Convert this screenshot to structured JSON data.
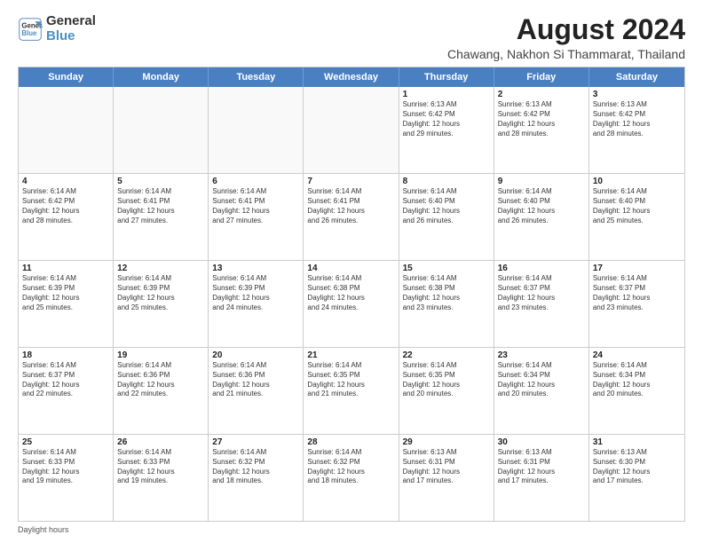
{
  "logo": {
    "line1": "General",
    "line2": "Blue"
  },
  "title": "August 2024",
  "location": "Chawang, Nakhon Si Thammarat, Thailand",
  "days_of_week": [
    "Sunday",
    "Monday",
    "Tuesday",
    "Wednesday",
    "Thursday",
    "Friday",
    "Saturday"
  ],
  "weeks": [
    [
      {
        "day": "",
        "text": "",
        "empty": true
      },
      {
        "day": "",
        "text": "",
        "empty": true
      },
      {
        "day": "",
        "text": "",
        "empty": true
      },
      {
        "day": "",
        "text": "",
        "empty": true
      },
      {
        "day": "1",
        "text": "Sunrise: 6:13 AM\nSunset: 6:42 PM\nDaylight: 12 hours\nand 29 minutes."
      },
      {
        "day": "2",
        "text": "Sunrise: 6:13 AM\nSunset: 6:42 PM\nDaylight: 12 hours\nand 28 minutes."
      },
      {
        "day": "3",
        "text": "Sunrise: 6:13 AM\nSunset: 6:42 PM\nDaylight: 12 hours\nand 28 minutes."
      }
    ],
    [
      {
        "day": "4",
        "text": "Sunrise: 6:14 AM\nSunset: 6:42 PM\nDaylight: 12 hours\nand 28 minutes."
      },
      {
        "day": "5",
        "text": "Sunrise: 6:14 AM\nSunset: 6:41 PM\nDaylight: 12 hours\nand 27 minutes."
      },
      {
        "day": "6",
        "text": "Sunrise: 6:14 AM\nSunset: 6:41 PM\nDaylight: 12 hours\nand 27 minutes."
      },
      {
        "day": "7",
        "text": "Sunrise: 6:14 AM\nSunset: 6:41 PM\nDaylight: 12 hours\nand 26 minutes."
      },
      {
        "day": "8",
        "text": "Sunrise: 6:14 AM\nSunset: 6:40 PM\nDaylight: 12 hours\nand 26 minutes."
      },
      {
        "day": "9",
        "text": "Sunrise: 6:14 AM\nSunset: 6:40 PM\nDaylight: 12 hours\nand 26 minutes."
      },
      {
        "day": "10",
        "text": "Sunrise: 6:14 AM\nSunset: 6:40 PM\nDaylight: 12 hours\nand 25 minutes."
      }
    ],
    [
      {
        "day": "11",
        "text": "Sunrise: 6:14 AM\nSunset: 6:39 PM\nDaylight: 12 hours\nand 25 minutes."
      },
      {
        "day": "12",
        "text": "Sunrise: 6:14 AM\nSunset: 6:39 PM\nDaylight: 12 hours\nand 25 minutes."
      },
      {
        "day": "13",
        "text": "Sunrise: 6:14 AM\nSunset: 6:39 PM\nDaylight: 12 hours\nand 24 minutes."
      },
      {
        "day": "14",
        "text": "Sunrise: 6:14 AM\nSunset: 6:38 PM\nDaylight: 12 hours\nand 24 minutes."
      },
      {
        "day": "15",
        "text": "Sunrise: 6:14 AM\nSunset: 6:38 PM\nDaylight: 12 hours\nand 23 minutes."
      },
      {
        "day": "16",
        "text": "Sunrise: 6:14 AM\nSunset: 6:37 PM\nDaylight: 12 hours\nand 23 minutes."
      },
      {
        "day": "17",
        "text": "Sunrise: 6:14 AM\nSunset: 6:37 PM\nDaylight: 12 hours\nand 23 minutes."
      }
    ],
    [
      {
        "day": "18",
        "text": "Sunrise: 6:14 AM\nSunset: 6:37 PM\nDaylight: 12 hours\nand 22 minutes."
      },
      {
        "day": "19",
        "text": "Sunrise: 6:14 AM\nSunset: 6:36 PM\nDaylight: 12 hours\nand 22 minutes."
      },
      {
        "day": "20",
        "text": "Sunrise: 6:14 AM\nSunset: 6:36 PM\nDaylight: 12 hours\nand 21 minutes."
      },
      {
        "day": "21",
        "text": "Sunrise: 6:14 AM\nSunset: 6:35 PM\nDaylight: 12 hours\nand 21 minutes."
      },
      {
        "day": "22",
        "text": "Sunrise: 6:14 AM\nSunset: 6:35 PM\nDaylight: 12 hours\nand 20 minutes."
      },
      {
        "day": "23",
        "text": "Sunrise: 6:14 AM\nSunset: 6:34 PM\nDaylight: 12 hours\nand 20 minutes."
      },
      {
        "day": "24",
        "text": "Sunrise: 6:14 AM\nSunset: 6:34 PM\nDaylight: 12 hours\nand 20 minutes."
      }
    ],
    [
      {
        "day": "25",
        "text": "Sunrise: 6:14 AM\nSunset: 6:33 PM\nDaylight: 12 hours\nand 19 minutes."
      },
      {
        "day": "26",
        "text": "Sunrise: 6:14 AM\nSunset: 6:33 PM\nDaylight: 12 hours\nand 19 minutes."
      },
      {
        "day": "27",
        "text": "Sunrise: 6:14 AM\nSunset: 6:32 PM\nDaylight: 12 hours\nand 18 minutes."
      },
      {
        "day": "28",
        "text": "Sunrise: 6:14 AM\nSunset: 6:32 PM\nDaylight: 12 hours\nand 18 minutes."
      },
      {
        "day": "29",
        "text": "Sunrise: 6:13 AM\nSunset: 6:31 PM\nDaylight: 12 hours\nand 17 minutes."
      },
      {
        "day": "30",
        "text": "Sunrise: 6:13 AM\nSunset: 6:31 PM\nDaylight: 12 hours\nand 17 minutes."
      },
      {
        "day": "31",
        "text": "Sunrise: 6:13 AM\nSunset: 6:30 PM\nDaylight: 12 hours\nand 17 minutes."
      }
    ]
  ],
  "footer": "Daylight hours"
}
